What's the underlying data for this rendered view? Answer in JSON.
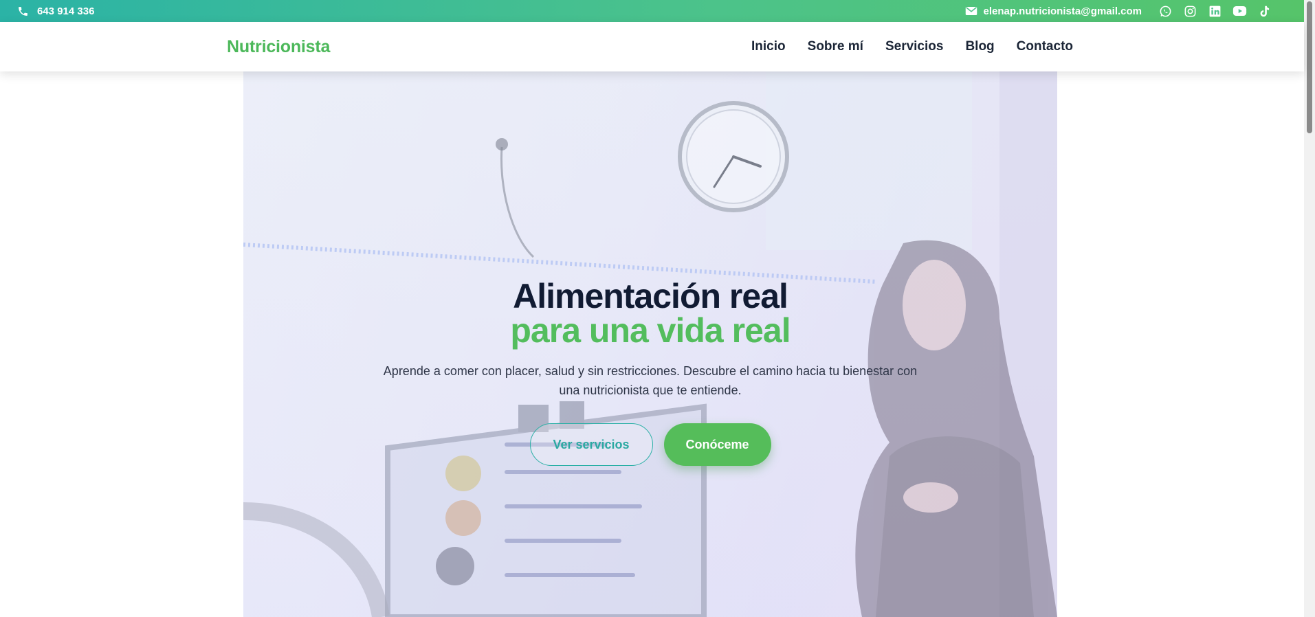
{
  "topbar": {
    "phone": "643 914 336",
    "email": "elenap.nutricionista@gmail.com",
    "social": [
      "whatsapp-icon",
      "instagram-icon",
      "linkedin-icon",
      "youtube-icon",
      "tiktok-icon"
    ]
  },
  "header": {
    "brand": "Nutricionista",
    "nav": [
      "Inicio",
      "Sobre mí",
      "Servicios",
      "Blog",
      "Contacto"
    ]
  },
  "hero": {
    "title_line1": "Alimentación real",
    "title_line2": "para una vida real",
    "subtitle": "Aprende a comer con placer, salud y sin restricciones. Descubre el camino hacia tu bienestar con una nutricionista que te entiende.",
    "primary_button": "Conóceme",
    "secondary_button": "Ver servicios"
  },
  "colors": {
    "accent_green": "#53bd5d",
    "accent_teal": "#2bb0a6",
    "heading_dark": "#111b33"
  }
}
